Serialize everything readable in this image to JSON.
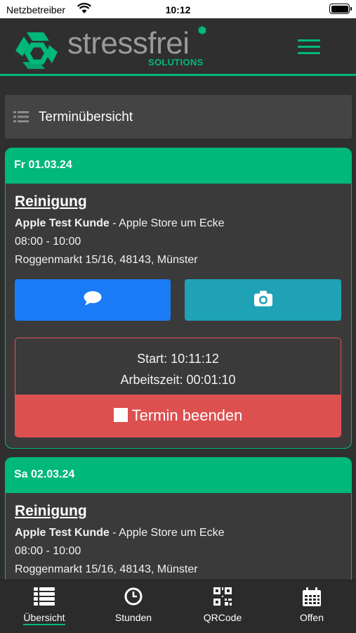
{
  "status_bar": {
    "carrier": "Netzbetreiber",
    "time": "10:12"
  },
  "header": {
    "logo_text": "stressfrei",
    "logo_sub": "SOLUTIONS",
    "accent": "#00b87a"
  },
  "overview": {
    "title": "Terminübersicht",
    "icon": "list-icon"
  },
  "appointments": [
    {
      "date": "Fr 01.03.24",
      "title": "Reinigung",
      "customer": "Apple Test Kunde",
      "location": " - Apple Store um Ecke",
      "time": "08:00 - 10:00",
      "address": "Roggenmarkt 15/16, 48143, Münster",
      "start": "Start: 10:11:12",
      "worktime": "Arbeitszeit: 00:01:10",
      "end_label": "Termin beenden"
    },
    {
      "date": "Sa 02.03.24",
      "title": "Reinigung",
      "customer": "Apple Test Kunde",
      "location": " - Apple Store um Ecke",
      "time": "08:00 - 10:00",
      "address": "Roggenmarkt 15/16, 48143, Münster"
    }
  ],
  "tabs": [
    {
      "label": "Übersicht",
      "icon": "list-icon",
      "active": true
    },
    {
      "label": "Stunden",
      "icon": "clock-icon"
    },
    {
      "label": "QRCode",
      "icon": "qrcode-icon"
    },
    {
      "label": "Offen",
      "icon": "calendar-icon"
    }
  ],
  "colors": {
    "green": "#00b87a",
    "chat_button": "#1a7bf7",
    "camera_button": "#1fa2b6",
    "end_button": "#dc5050"
  }
}
